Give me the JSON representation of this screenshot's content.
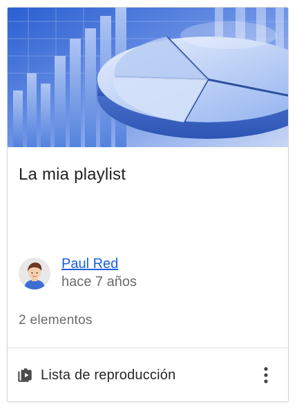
{
  "card": {
    "thumbnail_icon": "pie-chart-thumbnail",
    "title": "La mia playlist",
    "author": {
      "name": "Paul Red",
      "time": "hace 7 años",
      "avatar_icon": "user-avatar"
    },
    "item_count": "2 elementos",
    "footer": {
      "type_icon": "playlist-icon",
      "type_label": "Lista de reproducción",
      "menu_icon": "more-vert-icon"
    }
  },
  "colors": {
    "link": "#1a5fd6",
    "secondary_text": "#6b6b6b",
    "thumbnail_blue": "#3a6fd8"
  }
}
